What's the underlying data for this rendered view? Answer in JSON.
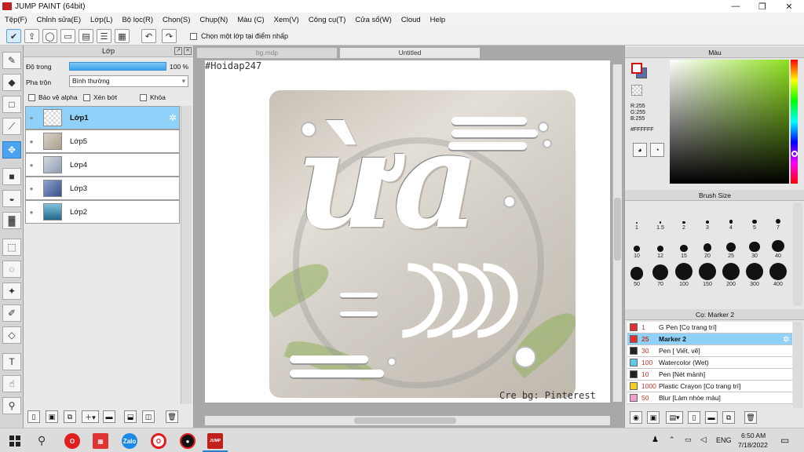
{
  "window": {
    "title": "JUMP PAINT (64bit)"
  },
  "menu": [
    "Tệp(F)",
    "Chỉnh sửa(E)",
    "Lớp(L)",
    "Bộ lọc(R)",
    "Chọn(S)",
    "Chụp(N)",
    "Màu (C)",
    "Xem(V)",
    "Công cụ(T)",
    "Cửa sổ(W)",
    "Cloud",
    "Help"
  ],
  "toolbar": {
    "checkbox_label": "Chọn một lớp tại điểm nhấp"
  },
  "layer_panel": {
    "title": "Lớp",
    "opacity_label": "Độ trong",
    "opacity_value": "100 %",
    "opacity_level": 1.0,
    "blend_label": "Pha trộn",
    "blend_value": "Bình thường",
    "protect_alpha": "Bảo vệ alpha",
    "clip": "Xén bớt",
    "lock": "Khóa",
    "layers": [
      {
        "name": "Lớp1",
        "selected": true
      },
      {
        "name": "Lớp5",
        "selected": false
      },
      {
        "name": "Lớp4",
        "selected": false
      },
      {
        "name": "Lớp3",
        "selected": false
      },
      {
        "name": "Lớp2",
        "selected": false
      }
    ]
  },
  "canvas": {
    "tabs": [
      "bg.mdp",
      "Untitled"
    ],
    "hashtag": "#Hoidap247",
    "credit": "Cre bg: Pinterest",
    "art_text": "ừa"
  },
  "color_panel": {
    "title": "Màu",
    "r": "R:255",
    "g": "G:255",
    "b": "B:255",
    "hex": "#FFFFFF"
  },
  "brush_size_panel": {
    "title": "Brush Size",
    "sizes": [
      "1",
      "1.5",
      "2",
      "3",
      "4",
      "5",
      "7",
      "10",
      "12",
      "15",
      "20",
      "25",
      "30",
      "40",
      "50",
      "70",
      "100",
      "150",
      "200",
      "300",
      "400"
    ]
  },
  "brush_list_panel": {
    "title": "Cọ: Marker 2",
    "items": [
      {
        "size": "1",
        "name": "G Pen [Cọ trang trí]",
        "color": "#e03030",
        "selected": false
      },
      {
        "size": "25",
        "name": "Marker 2",
        "color": "#e03030",
        "selected": true
      },
      {
        "size": "30",
        "name": "Pen [ Viết, vẽ]",
        "color": "#222222",
        "selected": false
      },
      {
        "size": "100",
        "name": "Watercolor (Wet)",
        "color": "#5ec8f0",
        "selected": false
      },
      {
        "size": "10",
        "name": "Pen [Nét mảnh]",
        "color": "#222222",
        "selected": false
      },
      {
        "size": "1000",
        "name": "Plastic Crayon [Cọ trang trí]",
        "color": "#f0d020",
        "selected": false
      },
      {
        "size": "50",
        "name": "Blur [Làm nhòe màu]",
        "color": "#f0a0d0",
        "selected": false
      }
    ]
  },
  "taskbar": {
    "time": "6:50 AM",
    "date": "7/18/2022",
    "lang": "ENG",
    "zalo": "Zalo",
    "jump": "JUMP"
  }
}
